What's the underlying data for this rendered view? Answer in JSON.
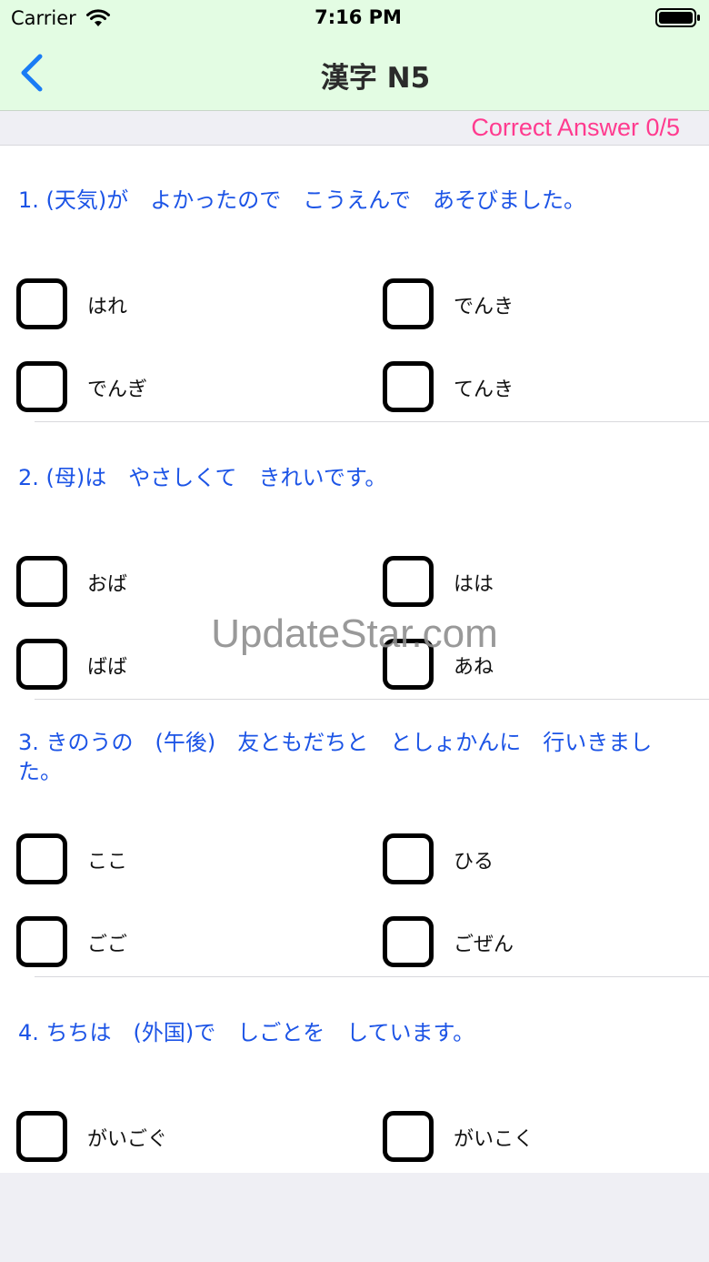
{
  "status_bar": {
    "carrier": "Carrier",
    "time": "7:16 PM"
  },
  "nav": {
    "title": "漢字 N5",
    "back_icon": "chevron-left-icon"
  },
  "score": {
    "label": "Correct Answer 0/5"
  },
  "questions": [
    {
      "text": "1. (天気)が　よかったので　こうえんで　あそびました。",
      "options": [
        "はれ",
        "でんき",
        "でんぎ",
        "てんき"
      ]
    },
    {
      "text": "2. (母)は　やさしくて　きれいです。",
      "options": [
        "おば",
        "はは",
        "ばば",
        "あね"
      ]
    },
    {
      "text": "3. きのうの　(午後)　友ともだちと　としょかんに　行いきました。",
      "options": [
        "ここ",
        "ひる",
        "ごご",
        "ごぜん"
      ]
    },
    {
      "text": "4. ちちは　(外国)で　しごとを　しています。",
      "options": [
        "がいごぐ",
        "がいこく"
      ]
    }
  ],
  "watermark": "UpdateStar.com",
  "colors": {
    "nav_bg": "#e3fce3",
    "question_text": "#1c54e6",
    "score_text": "#ff3b8f",
    "back_icon": "#1a7cf5"
  }
}
